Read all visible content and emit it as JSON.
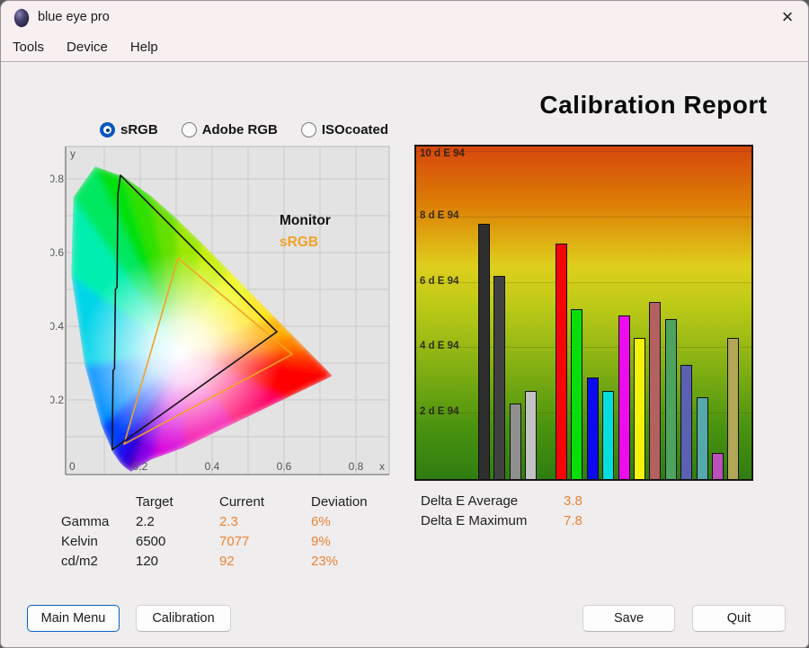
{
  "window": {
    "title": "blue eye pro"
  },
  "icons": {
    "close": "×",
    "app": "blue-egg"
  },
  "menu": {
    "items": [
      "Tools",
      "Device",
      "Help"
    ]
  },
  "report": {
    "title": "Calibration Report"
  },
  "profiles": [
    {
      "label": "sRGB",
      "selected": true
    },
    {
      "label": "Adobe RGB",
      "selected": false
    },
    {
      "label": "ISOcoated",
      "selected": false
    }
  ],
  "cie": {
    "axis": {
      "x_title": "x",
      "y_title": "y",
      "x_ticks": [
        {
          "v": 0,
          "label": "0"
        },
        {
          "v": 0.2,
          "label": "0.2"
        },
        {
          "v": 0.4,
          "label": "0.4"
        },
        {
          "v": 0.6,
          "label": "0.6"
        },
        {
          "v": 0.8,
          "label": "0.8"
        }
      ],
      "y_ticks": [
        {
          "v": 0.2,
          "label": "0.2"
        },
        {
          "v": 0.4,
          "label": "0.4"
        },
        {
          "v": 0.6,
          "label": "0.6"
        },
        {
          "v": 0.8,
          "label": "0.8"
        }
      ]
    },
    "legend": {
      "monitor": "Monitor",
      "srgb": "sRGB"
    },
    "monitor_color": "#141414",
    "srgb_color": "#f2a229",
    "monitor_gamut": [
      [
        0.145,
        0.81
      ],
      [
        0.58,
        0.385
      ],
      [
        0.122,
        0.065
      ],
      [
        0.1245,
        0.28
      ],
      [
        0.1285,
        0.285
      ],
      [
        0.131,
        0.5
      ],
      [
        0.1355,
        0.505
      ],
      [
        0.138,
        0.76
      ]
    ],
    "srgb_gamut": [
      [
        0.305,
        0.585
      ],
      [
        0.6225,
        0.324
      ],
      [
        0.155,
        0.08
      ]
    ],
    "white_point": [
      0.3127,
      0.329
    ],
    "locus": [
      [
        0.1741,
        0.005,
        "#2e00c8"
      ],
      [
        0.1566,
        0.0177,
        "#3300e0"
      ],
      [
        0.144,
        0.0297,
        "#1e0cf0"
      ],
      [
        0.1241,
        0.0578,
        "#0040ff"
      ],
      [
        0.0913,
        0.1327,
        "#0090ff"
      ],
      [
        0.0454,
        0.295,
        "#00d4e8"
      ],
      [
        0.0082,
        0.5384,
        "#00efb0"
      ],
      [
        0.0139,
        0.7502,
        "#00e860"
      ],
      [
        0.0743,
        0.8338,
        "#00e00c"
      ],
      [
        0.1547,
        0.8059,
        "#30e000"
      ],
      [
        0.2296,
        0.7543,
        "#66e000"
      ],
      [
        0.3016,
        0.6923,
        "#9ce800"
      ],
      [
        0.3731,
        0.6245,
        "#c8f000"
      ],
      [
        0.4441,
        0.5547,
        "#eef600"
      ],
      [
        0.5125,
        0.4866,
        "#ffe400"
      ],
      [
        0.5752,
        0.4242,
        "#ffb400"
      ],
      [
        0.627,
        0.3725,
        "#ff8200"
      ],
      [
        0.6658,
        0.334,
        "#ff4e00"
      ],
      [
        0.6915,
        0.3083,
        "#ff2600"
      ],
      [
        0.719,
        0.2809,
        "#ff0c00"
      ],
      [
        0.7347,
        0.2653,
        "#ff0000"
      ],
      [
        0.6,
        0.202,
        "#ff0066"
      ],
      [
        0.46,
        0.136,
        "#f400a6"
      ],
      [
        0.32,
        0.07,
        "#d800d8"
      ],
      [
        0.23,
        0.038,
        "#8a00e8"
      ]
    ]
  },
  "chart_data": {
    "type": "bar",
    "ylabel": "d E 94",
    "ylim": [
      0,
      10
    ],
    "grid": true,
    "legend_position": "none",
    "yticks": [
      {
        "value": 10,
        "label": "10 d E 94"
      },
      {
        "value": 8,
        "label": "8 d E 94"
      },
      {
        "value": 6,
        "label": "6 d E 94"
      },
      {
        "value": 4,
        "label": "4 d E 94"
      },
      {
        "value": 2,
        "label": "2 d E 94"
      }
    ],
    "bars": [
      {
        "name": "black",
        "value": 7.8,
        "color": "#2e2e2e"
      },
      {
        "name": "dark-gray",
        "value": 6.2,
        "color": "#414141"
      },
      {
        "name": "gray",
        "value": 2.3,
        "color": "#8f8f8f"
      },
      {
        "name": "light-gray",
        "value": 2.7,
        "color": "#c3c3c3"
      },
      {
        "name": "red",
        "value": 7.2,
        "color": "#f60507"
      },
      {
        "name": "green",
        "value": 5.2,
        "color": "#0ade0a"
      },
      {
        "name": "blue",
        "value": 3.1,
        "color": "#0b0bee"
      },
      {
        "name": "cyan",
        "value": 2.7,
        "color": "#06dede"
      },
      {
        "name": "magenta",
        "value": 5.0,
        "color": "#ee0cee"
      },
      {
        "name": "yellow",
        "value": 4.3,
        "color": "#f2f20a"
      },
      {
        "name": "rosy-brown",
        "value": 5.4,
        "color": "#b26060"
      },
      {
        "name": "sea-green",
        "value": 4.9,
        "color": "#4ea45e"
      },
      {
        "name": "slate-blue",
        "value": 3.5,
        "color": "#5a60b2"
      },
      {
        "name": "cadet-blue",
        "value": 2.5,
        "color": "#55a9ab"
      },
      {
        "name": "orchid",
        "value": 0.8,
        "color": "#bb50bb"
      },
      {
        "name": "dark-khaki",
        "value": 4.3,
        "color": "#b3a757"
      }
    ],
    "background_gradient": [
      "#d7470e",
      "#dc7d05",
      "#decf1c",
      "#bcca17",
      "#84b013",
      "#4b940f",
      "#2f7d11"
    ]
  },
  "results": {
    "headers": [
      "Target",
      "Current",
      "Deviation"
    ],
    "rows": [
      {
        "label": "Gamma",
        "target": "2.2",
        "current": "2.3",
        "deviation": "6%"
      },
      {
        "label": "Kelvin",
        "target": "6500",
        "current": "7077",
        "deviation": "9%"
      },
      {
        "label": "cd/m2",
        "target": "120",
        "current": "92",
        "deviation": "23%"
      }
    ],
    "delta": [
      {
        "label": "Delta E Average",
        "value": "3.8"
      },
      {
        "label": "Delta E Maximum",
        "value": "7.8"
      }
    ],
    "accent_color": "#ee8233"
  },
  "buttons": {
    "main_menu": "Main Menu",
    "calibration": "Calibration",
    "save": "Save",
    "quit": "Quit"
  }
}
